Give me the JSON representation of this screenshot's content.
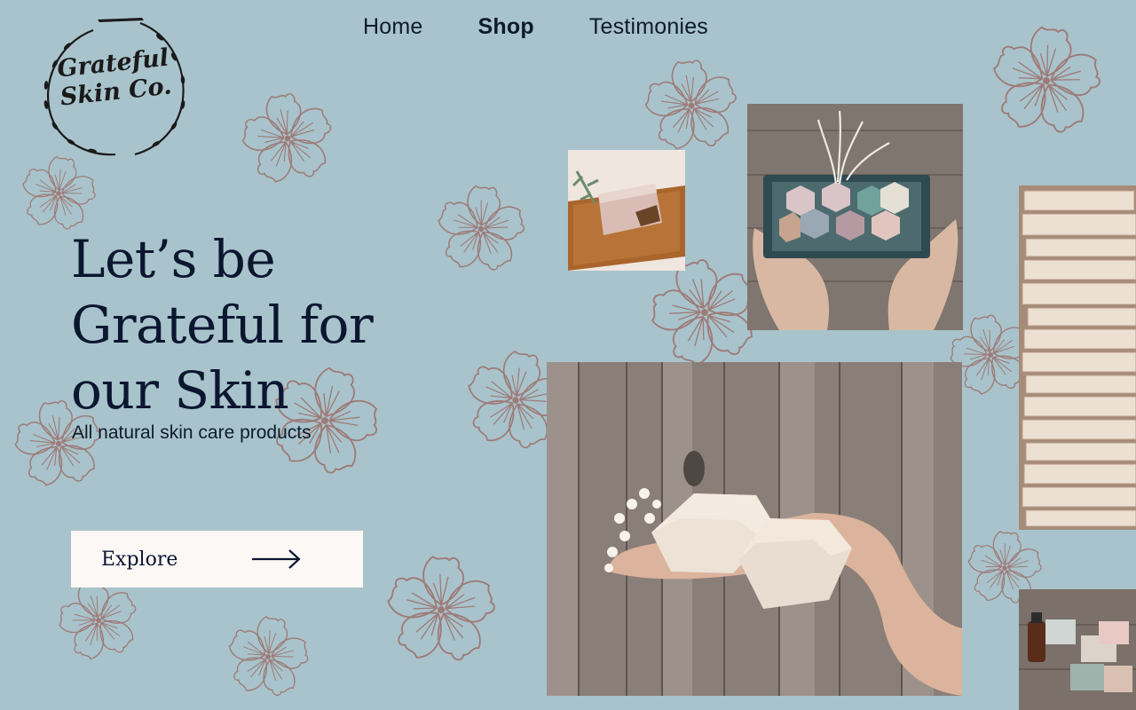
{
  "logo": {
    "line1": "Grateful",
    "line2": "Skin Co."
  },
  "nav": {
    "items": [
      {
        "label": "Home",
        "active": false
      },
      {
        "label": "Shop",
        "active": true
      },
      {
        "label": "Testimonies",
        "active": false
      }
    ]
  },
  "hero": {
    "title_lines": [
      "Let’s be",
      "Grateful for",
      "our Skin"
    ],
    "subtitle": "All natural skin care products",
    "cta_label": "Explore"
  },
  "icons": {
    "cta": "arrow-right-icon",
    "decor": "flower-icon"
  },
  "colors": {
    "background": "#a8c3cb",
    "text": "#0b1630",
    "flower": "#9e7b78",
    "button": "#fbf8f6",
    "wood": "#8a7f78"
  }
}
